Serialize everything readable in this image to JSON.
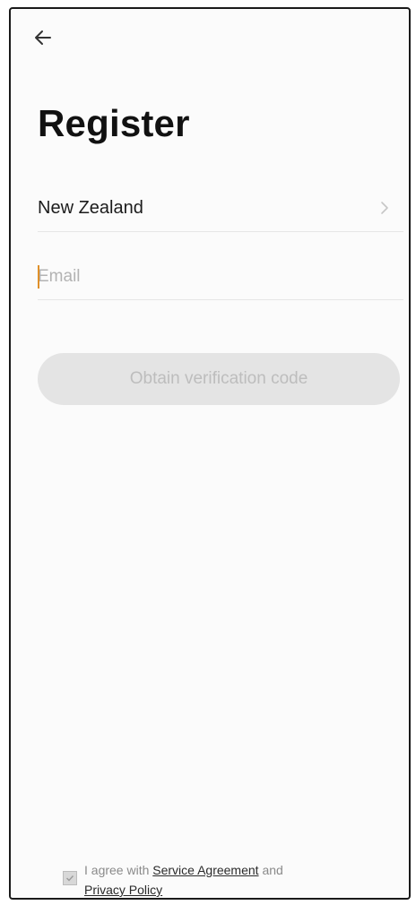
{
  "header": {
    "back_icon": "arrow-left-icon",
    "title": "Register"
  },
  "form": {
    "region": {
      "value": "New Zealand",
      "icon": "chevron-right-icon"
    },
    "email": {
      "placeholder": "Email",
      "value": ""
    },
    "obtain_button_label": "Obtain verification code"
  },
  "agreement": {
    "checkbox_icon": "checkbox-icon",
    "prefix": "I agree with ",
    "service_link": "Service Agreement",
    "conjunction": " and",
    "privacy_link": "Privacy Policy"
  },
  "colors": {
    "title": "#111111",
    "caret": "#e0902a",
    "disabled_button_bg": "#e4e4e4",
    "disabled_button_text": "#bdbdbd"
  }
}
